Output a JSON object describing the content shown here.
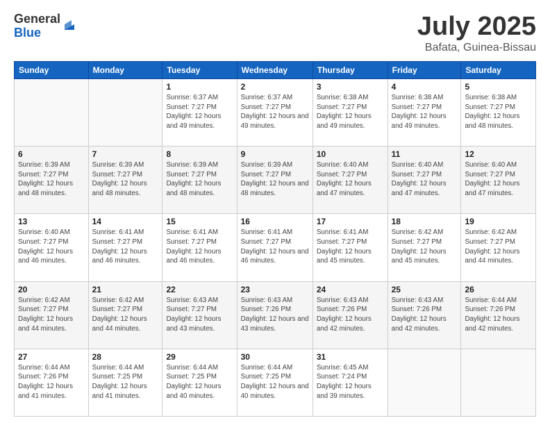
{
  "logo": {
    "general": "General",
    "blue": "Blue"
  },
  "header": {
    "month": "July 2025",
    "location": "Bafata, Guinea-Bissau"
  },
  "days_of_week": [
    "Sunday",
    "Monday",
    "Tuesday",
    "Wednesday",
    "Thursday",
    "Friday",
    "Saturday"
  ],
  "weeks": [
    [
      {
        "day": "",
        "info": ""
      },
      {
        "day": "",
        "info": ""
      },
      {
        "day": "1",
        "info": "Sunrise: 6:37 AM\nSunset: 7:27 PM\nDaylight: 12 hours and 49 minutes."
      },
      {
        "day": "2",
        "info": "Sunrise: 6:37 AM\nSunset: 7:27 PM\nDaylight: 12 hours and 49 minutes."
      },
      {
        "day": "3",
        "info": "Sunrise: 6:38 AM\nSunset: 7:27 PM\nDaylight: 12 hours and 49 minutes."
      },
      {
        "day": "4",
        "info": "Sunrise: 6:38 AM\nSunset: 7:27 PM\nDaylight: 12 hours and 49 minutes."
      },
      {
        "day": "5",
        "info": "Sunrise: 6:38 AM\nSunset: 7:27 PM\nDaylight: 12 hours and 48 minutes."
      }
    ],
    [
      {
        "day": "6",
        "info": "Sunrise: 6:39 AM\nSunset: 7:27 PM\nDaylight: 12 hours and 48 minutes."
      },
      {
        "day": "7",
        "info": "Sunrise: 6:39 AM\nSunset: 7:27 PM\nDaylight: 12 hours and 48 minutes."
      },
      {
        "day": "8",
        "info": "Sunrise: 6:39 AM\nSunset: 7:27 PM\nDaylight: 12 hours and 48 minutes."
      },
      {
        "day": "9",
        "info": "Sunrise: 6:39 AM\nSunset: 7:27 PM\nDaylight: 12 hours and 48 minutes."
      },
      {
        "day": "10",
        "info": "Sunrise: 6:40 AM\nSunset: 7:27 PM\nDaylight: 12 hours and 47 minutes."
      },
      {
        "day": "11",
        "info": "Sunrise: 6:40 AM\nSunset: 7:27 PM\nDaylight: 12 hours and 47 minutes."
      },
      {
        "day": "12",
        "info": "Sunrise: 6:40 AM\nSunset: 7:27 PM\nDaylight: 12 hours and 47 minutes."
      }
    ],
    [
      {
        "day": "13",
        "info": "Sunrise: 6:40 AM\nSunset: 7:27 PM\nDaylight: 12 hours and 46 minutes."
      },
      {
        "day": "14",
        "info": "Sunrise: 6:41 AM\nSunset: 7:27 PM\nDaylight: 12 hours and 46 minutes."
      },
      {
        "day": "15",
        "info": "Sunrise: 6:41 AM\nSunset: 7:27 PM\nDaylight: 12 hours and 46 minutes."
      },
      {
        "day": "16",
        "info": "Sunrise: 6:41 AM\nSunset: 7:27 PM\nDaylight: 12 hours and 46 minutes."
      },
      {
        "day": "17",
        "info": "Sunrise: 6:41 AM\nSunset: 7:27 PM\nDaylight: 12 hours and 45 minutes."
      },
      {
        "day": "18",
        "info": "Sunrise: 6:42 AM\nSunset: 7:27 PM\nDaylight: 12 hours and 45 minutes."
      },
      {
        "day": "19",
        "info": "Sunrise: 6:42 AM\nSunset: 7:27 PM\nDaylight: 12 hours and 44 minutes."
      }
    ],
    [
      {
        "day": "20",
        "info": "Sunrise: 6:42 AM\nSunset: 7:27 PM\nDaylight: 12 hours and 44 minutes."
      },
      {
        "day": "21",
        "info": "Sunrise: 6:42 AM\nSunset: 7:27 PM\nDaylight: 12 hours and 44 minutes."
      },
      {
        "day": "22",
        "info": "Sunrise: 6:43 AM\nSunset: 7:27 PM\nDaylight: 12 hours and 43 minutes."
      },
      {
        "day": "23",
        "info": "Sunrise: 6:43 AM\nSunset: 7:26 PM\nDaylight: 12 hours and 43 minutes."
      },
      {
        "day": "24",
        "info": "Sunrise: 6:43 AM\nSunset: 7:26 PM\nDaylight: 12 hours and 42 minutes."
      },
      {
        "day": "25",
        "info": "Sunrise: 6:43 AM\nSunset: 7:26 PM\nDaylight: 12 hours and 42 minutes."
      },
      {
        "day": "26",
        "info": "Sunrise: 6:44 AM\nSunset: 7:26 PM\nDaylight: 12 hours and 42 minutes."
      }
    ],
    [
      {
        "day": "27",
        "info": "Sunrise: 6:44 AM\nSunset: 7:26 PM\nDaylight: 12 hours and 41 minutes."
      },
      {
        "day": "28",
        "info": "Sunrise: 6:44 AM\nSunset: 7:25 PM\nDaylight: 12 hours and 41 minutes."
      },
      {
        "day": "29",
        "info": "Sunrise: 6:44 AM\nSunset: 7:25 PM\nDaylight: 12 hours and 40 minutes."
      },
      {
        "day": "30",
        "info": "Sunrise: 6:44 AM\nSunset: 7:25 PM\nDaylight: 12 hours and 40 minutes."
      },
      {
        "day": "31",
        "info": "Sunrise: 6:45 AM\nSunset: 7:24 PM\nDaylight: 12 hours and 39 minutes."
      },
      {
        "day": "",
        "info": ""
      },
      {
        "day": "",
        "info": ""
      }
    ]
  ]
}
